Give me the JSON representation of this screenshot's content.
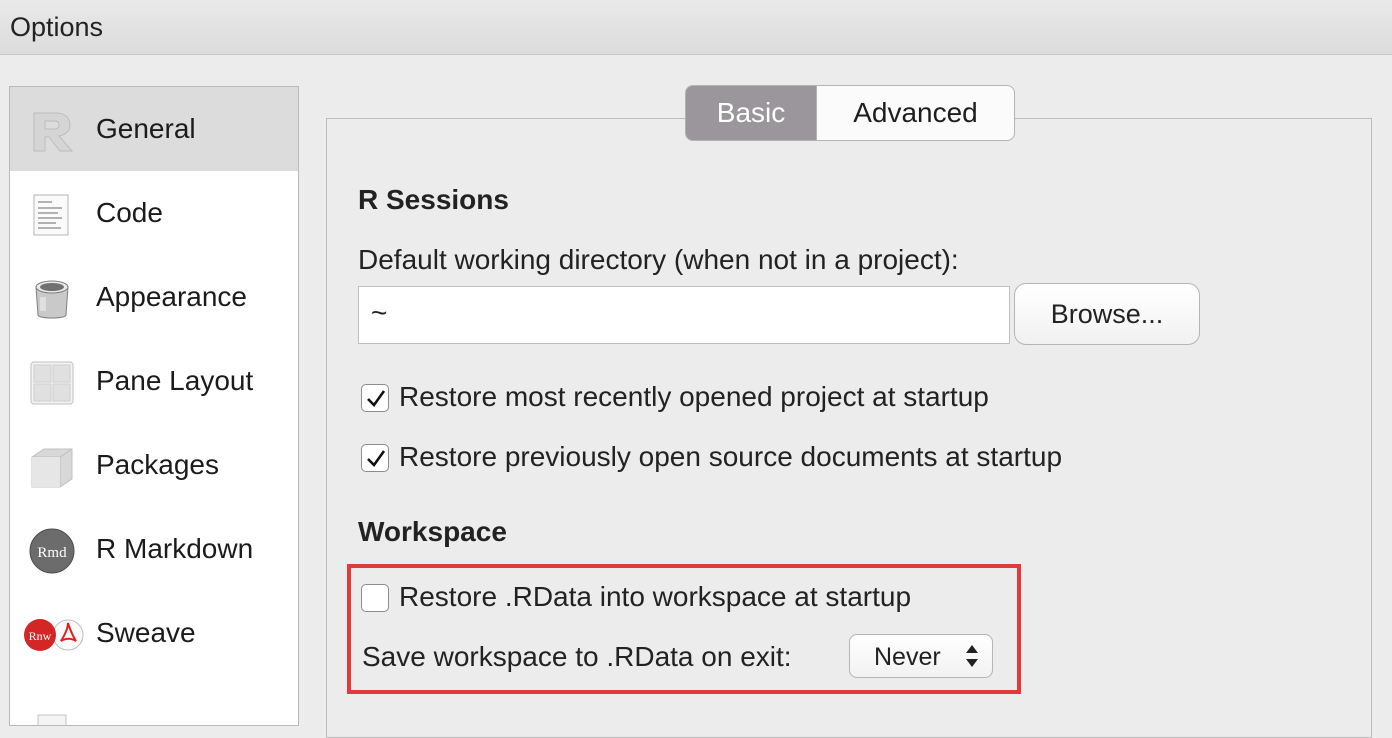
{
  "window": {
    "title": "Options"
  },
  "sidebar": {
    "items": [
      {
        "label": "General",
        "icon": "r-logo-icon",
        "active": true
      },
      {
        "label": "Code",
        "icon": "code-document-icon"
      },
      {
        "label": "Appearance",
        "icon": "paint-bucket-icon"
      },
      {
        "label": "Pane Layout",
        "icon": "pane-grid-icon"
      },
      {
        "label": "Packages",
        "icon": "package-box-icon"
      },
      {
        "label": "R Markdown",
        "icon": "rmd-icon"
      },
      {
        "label": "Sweave",
        "icon": "sweave-pdf-icon"
      }
    ]
  },
  "tabs": [
    {
      "label": "Basic",
      "active": true
    },
    {
      "label": "Advanced",
      "active": false
    }
  ],
  "r_sessions": {
    "heading": "R Sessions",
    "dir_label": "Default working directory (when not in a project):",
    "dir_value": "~",
    "browse_label": "Browse...",
    "restore_project_label": "Restore most recently opened project at startup",
    "restore_project_checked": true,
    "restore_docs_label": "Restore previously open source documents at startup",
    "restore_docs_checked": true
  },
  "workspace": {
    "heading": "Workspace",
    "restore_rdata_label": "Restore .RData into workspace at startup",
    "restore_rdata_checked": false,
    "save_label": "Save workspace to .RData on exit:",
    "save_value": "Never"
  },
  "colors": {
    "highlight": "#e03a3a",
    "active_tab": "#9b969b"
  }
}
